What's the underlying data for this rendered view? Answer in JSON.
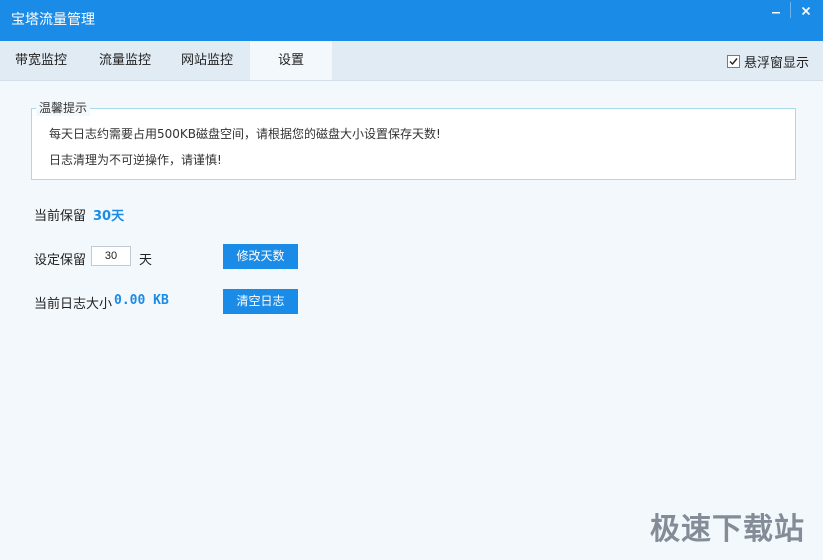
{
  "window": {
    "title": "宝塔流量管理"
  },
  "tabs": [
    {
      "label": "带宽监控",
      "active": false
    },
    {
      "label": "流量监控",
      "active": false
    },
    {
      "label": "网站监控",
      "active": false
    },
    {
      "label": "设置",
      "active": true
    }
  ],
  "float_window": {
    "label": "悬浮窗显示",
    "checked": true
  },
  "notice": {
    "legend": "温馨提示",
    "line1": "每天日志约需要占用500KB磁盘空间，请根据您的磁盘大小设置保存天数!",
    "line2": "日志清理为不可逆操作，请谨慎!"
  },
  "settings": {
    "current_label": "当前保留",
    "current_value": "30天",
    "set_label": "设定保留",
    "set_value": "30",
    "set_unit": "天",
    "modify_button": "修改天数",
    "log_size_label": "当前日志大小",
    "log_size_value": "0.00 KB",
    "clear_button": "清空日志"
  },
  "watermark": "极速下载站",
  "colors": {
    "accent": "#1a8be6",
    "tab_bar": "#e1ebf4",
    "background": "#f3f8fc"
  }
}
